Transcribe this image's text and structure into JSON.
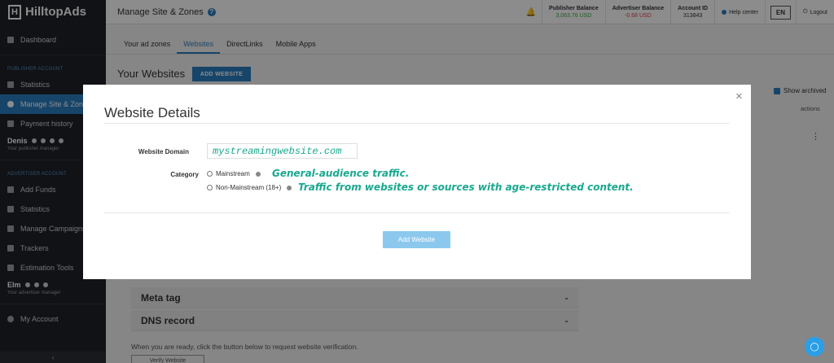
{
  "app": {
    "logo_text": "HilltopAds",
    "page_title": "Manage Site & Zones"
  },
  "topbar": {
    "publisher_balance_label": "Publisher Balance",
    "publisher_balance_value": "3,063.76 USD",
    "advertiser_balance_label": "Advertiser Balance",
    "advertiser_balance_value": "-0.68 USD",
    "account_id_label": "Account ID",
    "account_id_value": "313843",
    "help_center": "Help center",
    "language": "EN",
    "logout": "Logout"
  },
  "sidebar": {
    "dashboard": "Dashboard",
    "publisher_section": "PUBLISHER ACCOUNT",
    "publisher_items": [
      "Statistics",
      "Manage Site & Zones",
      "Payment history"
    ],
    "publisher_manager_name": "Denis",
    "publisher_manager_sub": "Your publisher manager",
    "advertiser_section": "ADVERTISER ACCOUNT",
    "advertiser_items": [
      "Add Funds",
      "Statistics",
      "Manage Campaigns",
      "Trackers",
      "Estimation Tools"
    ],
    "advertiser_manager_name": "Elm",
    "advertiser_manager_sub": "Your advertiser manager",
    "my_account": "My Account"
  },
  "main": {
    "tabs": [
      "Your ad zones",
      "Websites",
      "DirectLinks",
      "Mobile Apps"
    ],
    "section_title": "Your Websites",
    "add_website_button": "ADD WEBSITE",
    "show_archived": "Show archived",
    "actions_header": "actions",
    "accordion_meta": "Meta tag",
    "accordion_dns": "DNS record",
    "verify_text": "When you are ready, click the button below to request website verification.",
    "verify_button": "Verify Website"
  },
  "modal": {
    "title": "Website Details",
    "domain_label": "Website Domain",
    "domain_value": "mystreamingwebsite.com",
    "category_label": "Category",
    "option_mainstream": "Mainstream",
    "option_non_mainstream": "Non-Mainstream (18+)",
    "annotation_mainstream": "General-audience traffic.",
    "annotation_non_mainstream": "Traffic from websites or sources with age-restricted content.",
    "submit_button": "Add Website"
  }
}
